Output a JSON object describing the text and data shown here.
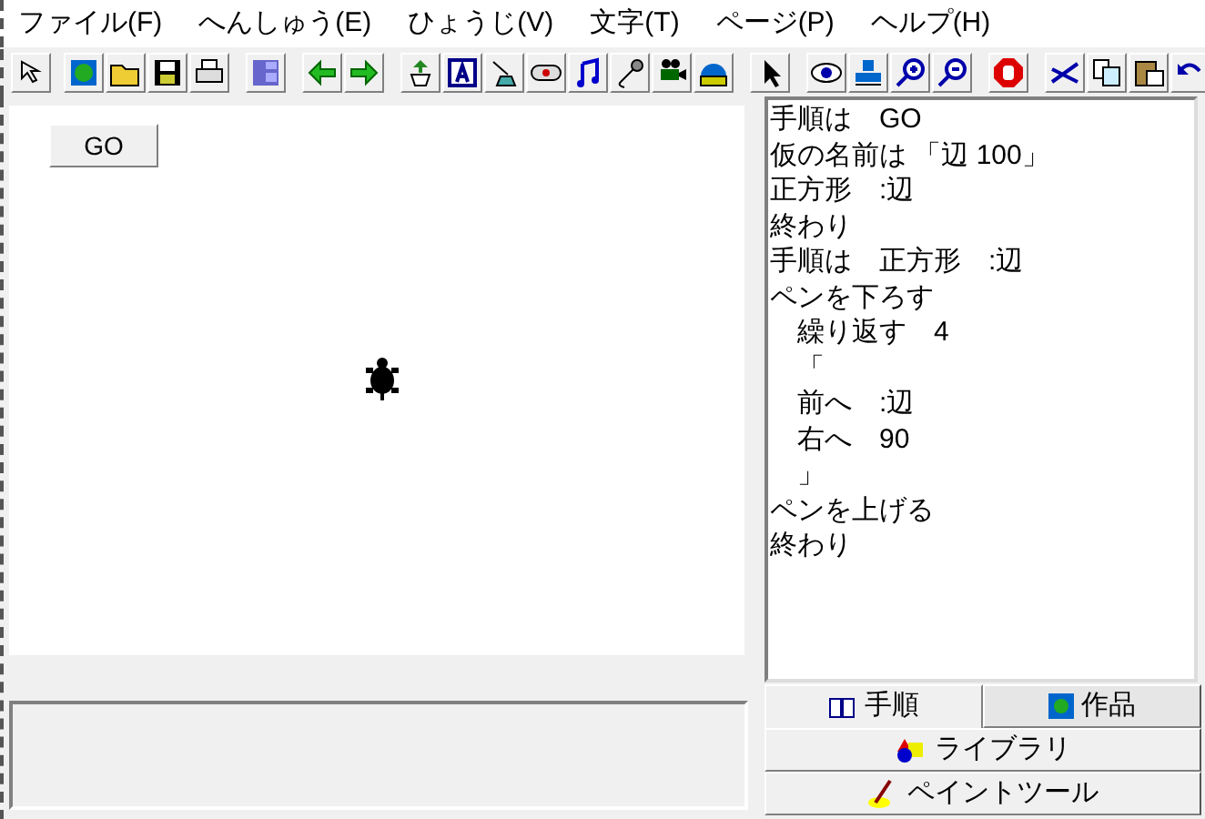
{
  "menu": [
    "ファイル(F)",
    "へんしゅう(E)",
    "ひょうじ(V)",
    "文字(T)",
    "ページ(P)",
    "ヘルプ(H)"
  ],
  "canvas": {
    "go_button": "GO"
  },
  "code_lines": [
    "手順は　GO",
    "仮の名前は 「辺 100」",
    "正方形　:辺",
    "終わり",
    "手順は　正方形　:辺",
    "ペンを下ろす",
    "　繰り返す　4",
    "　「",
    "　前へ　:辺",
    "　右へ　90",
    "　」",
    "ペンを上げる",
    "終わり"
  ],
  "tabs": [
    {
      "label": "手順",
      "selected": true
    },
    {
      "label": "作品",
      "selected": false
    }
  ],
  "panel_buttons": [
    "ライブラリ",
    "ペイントツール"
  ]
}
